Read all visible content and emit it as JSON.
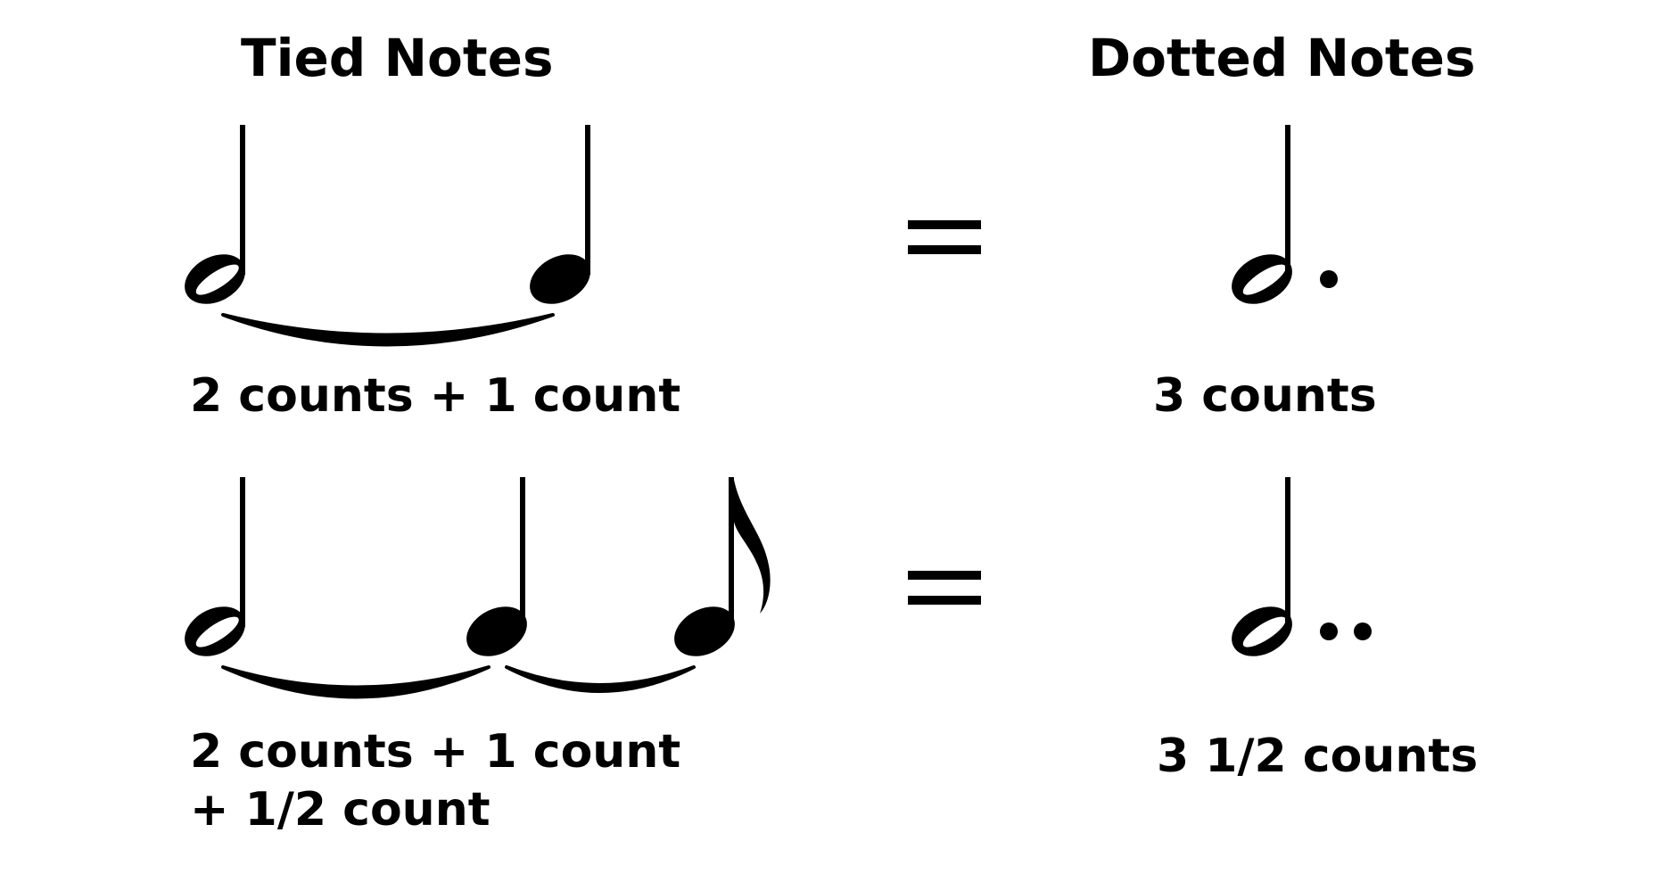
{
  "headings": {
    "tied": "Tied Notes",
    "dotted": "Dotted Notes"
  },
  "rows": [
    {
      "tied_label_line1": "2 counts + 1 count",
      "tied_label_line2": "",
      "equals": "=",
      "dotted_label": "3 counts",
      "tied_notes": [
        "half-note",
        "quarter-note"
      ],
      "dotted_note": "dotted-half-note"
    },
    {
      "tied_label_line1": "2 counts + 1 count",
      "tied_label_line2": "+ 1/2 count",
      "equals": "=",
      "dotted_label": "3 1/2 counts",
      "tied_notes": [
        "half-note",
        "quarter-note",
        "eighth-note"
      ],
      "dotted_note": "double-dotted-half-note"
    }
  ],
  "colors": {
    "ink": "#000000",
    "background": "#ffffff"
  }
}
